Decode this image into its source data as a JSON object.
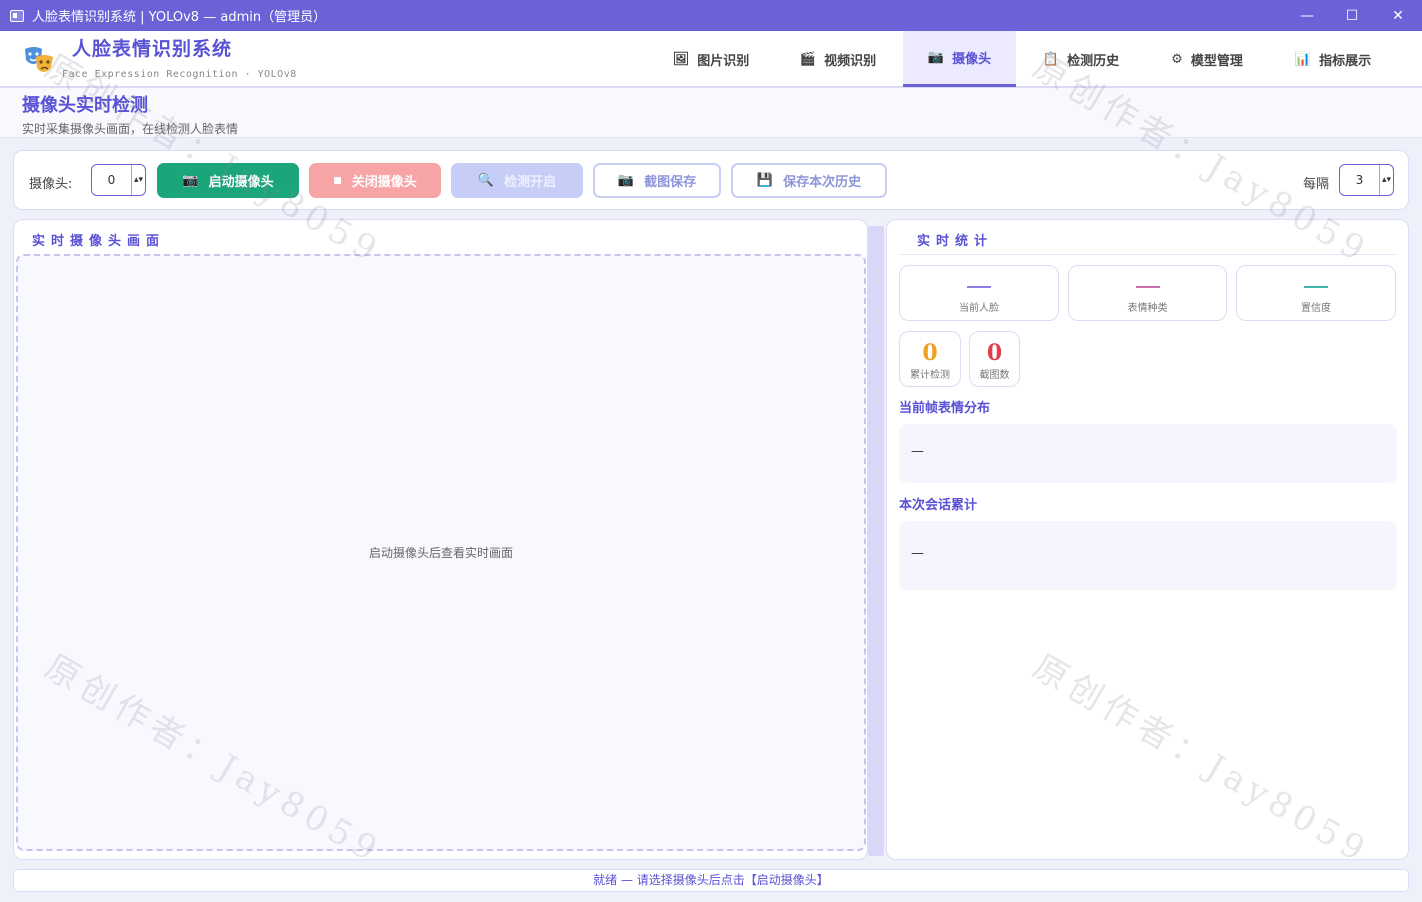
{
  "window": {
    "title": "人脸表情识别系统 | YOLOv8 — admin（管理员）",
    "minimize": "—",
    "maximize": "☐",
    "close": "✕"
  },
  "brand": {
    "title": "人脸表情识别系统",
    "subtitle": "Face Expression Recognition  ·  YOLOv8",
    "logo_icon": "theater-masks-icon"
  },
  "nav": [
    {
      "label": "图片识别",
      "icon": "🖼"
    },
    {
      "label": "视频识别",
      "icon": "🎬"
    },
    {
      "label": "摄像头",
      "icon": "📷",
      "active": true
    },
    {
      "label": "检测历史",
      "icon": "📋"
    },
    {
      "label": "模型管理",
      "icon": "⚙"
    },
    {
      "label": "指标展示",
      "icon": "📊"
    }
  ],
  "page": {
    "title": "摄像头实时检测",
    "subtitle": "实时采集摄像头画面，在线检测人脸表情"
  },
  "toolbar": {
    "camera_label": "摄像头:",
    "camera_value": "0",
    "start_icon": "📷",
    "start_label": "启动摄像头",
    "stop_icon": "■",
    "stop_label": "关闭摄像头",
    "detect_icon": "🔍",
    "detect_label": "检测开启",
    "snapshot_icon": "📷",
    "snapshot_label": "截图保存",
    "save_icon": "💾",
    "save_label": "保存本次历史",
    "interval_label": "每隔",
    "interval_value": "3",
    "spin_arrow": "▴▾"
  },
  "video_panel": {
    "title": "实时摄像头画面",
    "placeholder": "启动摄像头后查看实时画面"
  },
  "stats_panel": {
    "title": "实时统计",
    "cards": [
      {
        "label": "当前人脸",
        "color": "#8a7fe0"
      },
      {
        "label": "表情种类",
        "color": "#c86fb0"
      },
      {
        "label": "置信度",
        "color": "#3fb7a8"
      }
    ],
    "mini": [
      {
        "value": "0",
        "label": "累计检测",
        "color": "#f0a020"
      },
      {
        "value": "0",
        "label": "截图数",
        "color": "#e0404a"
      }
    ],
    "frame_dist_title": "当前帧表情分布",
    "frame_dist_value": "—",
    "session_title": "本次会话累计",
    "session_value": "—"
  },
  "status": {
    "text": "就绪 — 请选择摄像头后点击【启动摄像头】"
  },
  "watermark": {
    "text": "原创作者：Jay8059"
  }
}
